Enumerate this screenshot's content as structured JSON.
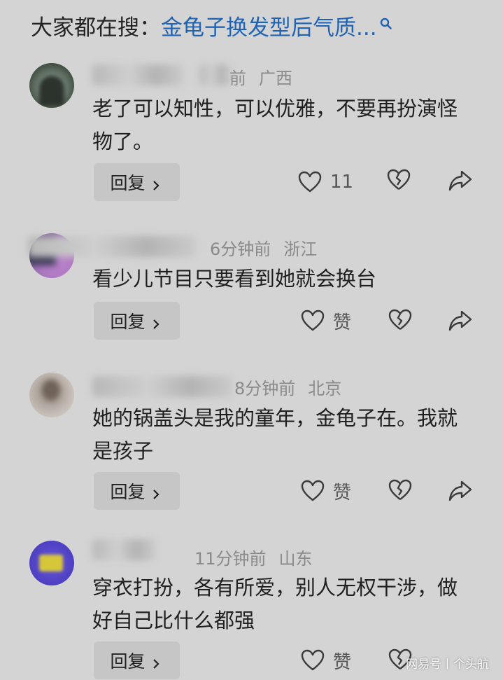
{
  "search": {
    "prefix": "大家都在搜：",
    "query": "金龟子换发型后气质...",
    "accent_color": "#1f64b4"
  },
  "comments": [
    {
      "time": "",
      "time_partial": "前",
      "location": "广西",
      "text": "老了可以知性，可以优雅，不要再扮演怪物了。",
      "reply_label": "回复",
      "like_label": "11",
      "avatar_colors": [
        "#3d4a3d",
        "#6f7f73",
        "#a7b8aa"
      ]
    },
    {
      "time": "6分钟前",
      "location": "浙江",
      "text": "看少儿节目只要看到她就会换台",
      "reply_label": "回复",
      "like_label": "赞",
      "avatar_colors": [
        "#c084d0",
        "#3a3a55",
        "#9b6fb5"
      ]
    },
    {
      "time": "8分钟前",
      "location": "北京",
      "text": "她的锅盖头是我的童年，金龟子在。我就是孩子",
      "reply_label": "回复",
      "like_label": "赞",
      "avatar_colors": [
        "#9a8d82",
        "#c9c2bb",
        "#6f6259"
      ]
    },
    {
      "time": "11分钟前",
      "location": "山东",
      "text": "穿衣打扮，各有所爱，别人无权干涉，做好自己比什么都强",
      "reply_label": "回复",
      "like_label": "赞",
      "avatar_colors": [
        "#4a3cc0",
        "#d6c63a",
        "#6c5ad6"
      ]
    }
  ],
  "watermark": "网易号丨个头航",
  "icons": [
    "search-icon",
    "heart-icon",
    "broken-heart-icon",
    "share-icon",
    "chevron-right-icon"
  ]
}
